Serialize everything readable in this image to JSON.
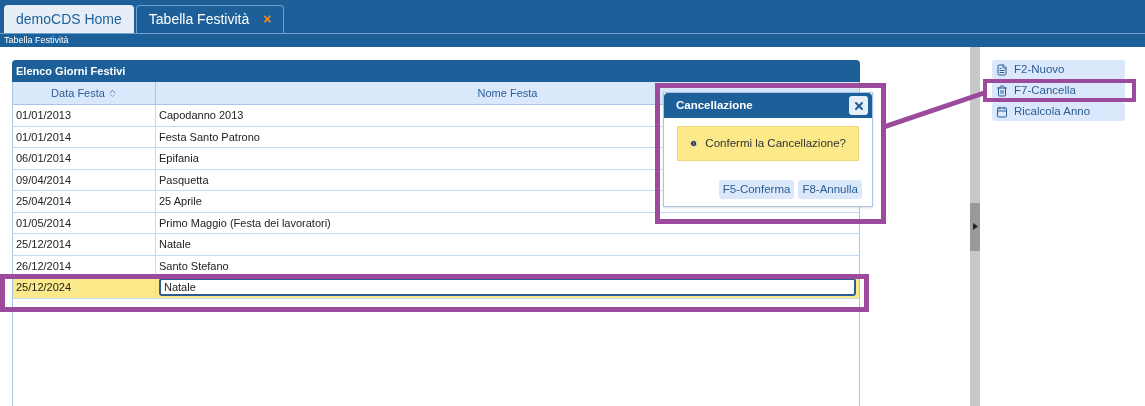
{
  "tabs": [
    {
      "label": "demoCDS Home",
      "selected": false
    },
    {
      "label": "Tabella Festività",
      "selected": true,
      "close": "×"
    }
  ],
  "breadcrumb": "Tabella Festività",
  "grid": {
    "title": "Elenco Giorni Festivi",
    "columns": [
      {
        "label": "Data Festa",
        "sorted": true
      },
      {
        "label": "Nome Festa",
        "sorted": false
      }
    ],
    "rows": [
      {
        "date": "01/01/2013",
        "name": "Capodanno 2013",
        "selected": false
      },
      {
        "date": "01/01/2014",
        "name": "Festa Santo Patrono",
        "selected": false
      },
      {
        "date": "06/01/2014",
        "name": "Epifania",
        "selected": false
      },
      {
        "date": "09/04/2014",
        "name": "Pasquetta",
        "selected": false
      },
      {
        "date": "25/04/2014",
        "name": "25 Aprile",
        "selected": false
      },
      {
        "date": "01/05/2014",
        "name": "Primo Maggio (Festa dei lavoratori)",
        "selected": false
      },
      {
        "date": "25/12/2014",
        "name": "Natale",
        "selected": false
      },
      {
        "date": "26/12/2014",
        "name": "Santo Stefano",
        "selected": false
      },
      {
        "date": "25/12/2024",
        "name": "Natale",
        "selected": true
      }
    ]
  },
  "dialog": {
    "title": "Cancellazione",
    "message": "Confermi la Cancellazione?",
    "buttons": [
      "F5-Conferma",
      "F8-Annulla"
    ]
  },
  "actions": [
    {
      "kind": "new",
      "label": "F2-Nuovo"
    },
    {
      "kind": "delete",
      "label": "F7-Cancella"
    },
    {
      "kind": "calendar",
      "label": "Ricalcola Anno"
    }
  ]
}
